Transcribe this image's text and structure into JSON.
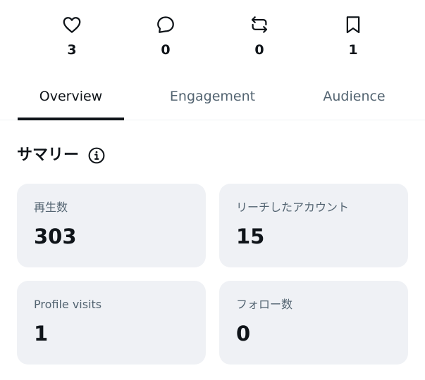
{
  "actions": [
    {
      "icon": "heart-icon",
      "count": "3"
    },
    {
      "icon": "reply-icon",
      "count": "0"
    },
    {
      "icon": "repost-icon",
      "count": "0"
    },
    {
      "icon": "bookmark-icon",
      "count": "1"
    }
  ],
  "tabs": [
    {
      "label": "Overview",
      "active": true
    },
    {
      "label": "Engagement",
      "active": false
    },
    {
      "label": "Audience",
      "active": false
    }
  ],
  "summary": {
    "title": "サマリー",
    "info_icon": "info-icon",
    "cards": [
      {
        "label": "再生数",
        "value": "303"
      },
      {
        "label": "リーチしたアカウント",
        "value": "15"
      },
      {
        "label": "Profile visits",
        "value": "1"
      },
      {
        "label": "フォロー数",
        "value": "0"
      }
    ]
  },
  "colors": {
    "text_primary": "#0f1419",
    "text_secondary": "#536471",
    "card_background": "#eff1f5",
    "divider": "#eff3f4"
  }
}
